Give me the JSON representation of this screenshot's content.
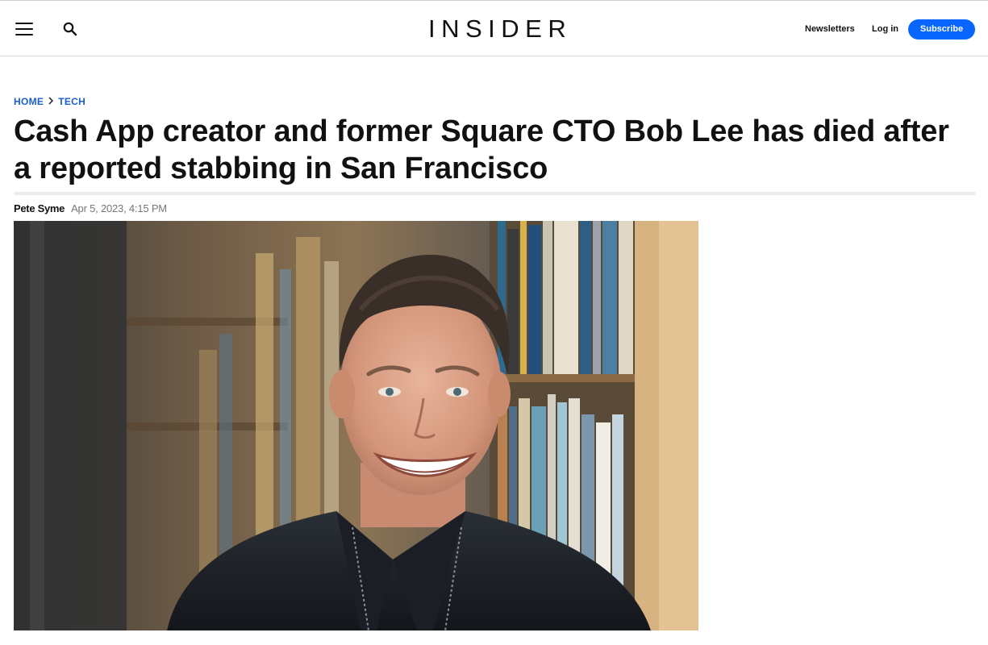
{
  "header": {
    "logo_text": "INSIDER",
    "menu_icon": "hamburger-menu-icon",
    "search_icon": "search-icon",
    "newsletters_label": "Newsletters",
    "login_label": "Log in",
    "subscribe_label": "Subscribe",
    "subscribe_color": "#0866ff"
  },
  "breadcrumb": {
    "items": [
      "HOME",
      "TECH"
    ],
    "separator_icon": "chevron-right-icon",
    "color": "#1a5fc8"
  },
  "article": {
    "headline": "Cash App creator and former Square CTO Bob Lee has died after a reported stabbing in San Francisco",
    "author": "Pete Syme",
    "date": "Apr 5, 2023, 4:15 PM"
  },
  "hero_image": {
    "alt": "Smiling man with short hair in a dark jacket standing in front of bookshelves"
  }
}
